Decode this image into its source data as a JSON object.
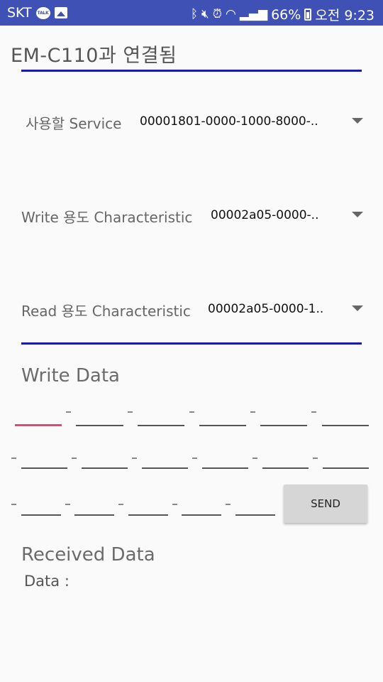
{
  "status_bar": {
    "carrier": "SKT",
    "talk_badge": "TALK",
    "battery_percent": "66%",
    "time": "오전 9:23",
    "bg_color": "#3f51b5"
  },
  "header": {
    "title": "EM-C110과 연결됨"
  },
  "spinners": [
    {
      "label": "사용할 Service",
      "value": "00001801-0000-1000-8000-.."
    },
    {
      "label": "Write 용도 Characteristic",
      "value": "00002a05-0000-.."
    },
    {
      "label": "Read 용도 Characteristic",
      "value": "00002a05-0000-1.."
    }
  ],
  "write_section": {
    "title": "Write Data",
    "send_label": "SEND",
    "field_count": 17,
    "focus_color": "#e0457b"
  },
  "received_section": {
    "title": "Received Data",
    "data_label": "Data :",
    "data_value": ""
  },
  "accent_color": "#1a1ab0"
}
